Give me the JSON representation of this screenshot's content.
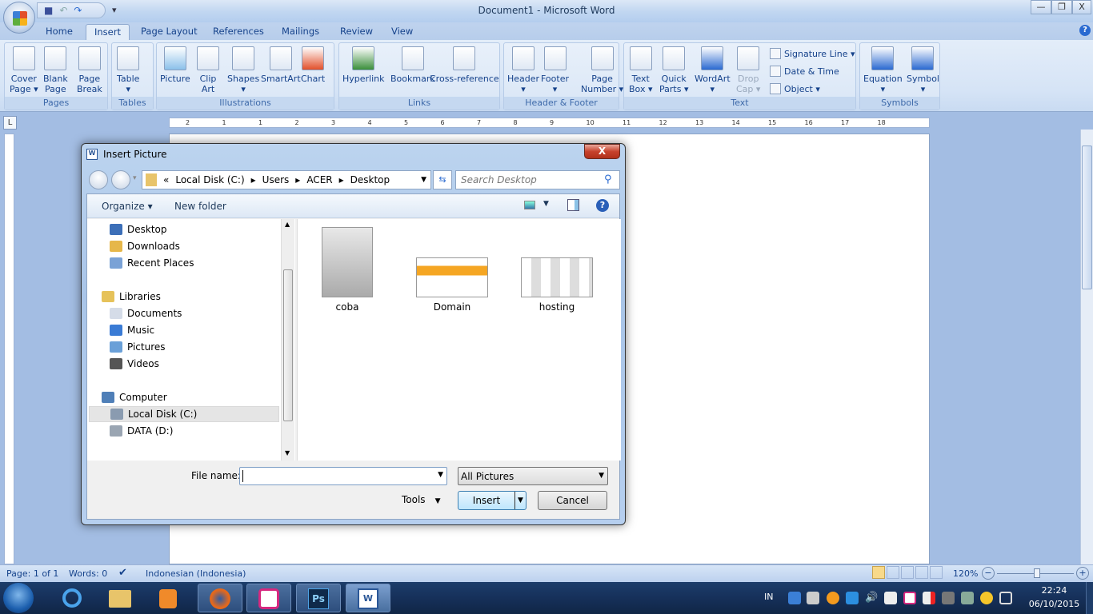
{
  "window": {
    "title": "Document1 - Microsoft Word",
    "minimize": "—",
    "restore": "❐",
    "close": "X"
  },
  "tabs": [
    "Home",
    "Insert",
    "Page Layout",
    "References",
    "Mailings",
    "Review",
    "View"
  ],
  "active_tab": "Insert",
  "ribbon": {
    "groups": [
      {
        "label": "Pages",
        "buttons": [
          "Cover\nPage ▾",
          "Blank\nPage",
          "Page\nBreak"
        ]
      },
      {
        "label": "Tables",
        "buttons": [
          "Table\n▾"
        ]
      },
      {
        "label": "Illustrations",
        "buttons": [
          "Picture",
          "Clip\nArt",
          "Shapes\n▾",
          "SmartArt",
          "Chart"
        ]
      },
      {
        "label": "Links",
        "buttons": [
          "Hyperlink",
          "Bookmark",
          "Cross-reference"
        ]
      },
      {
        "label": "Header & Footer",
        "buttons": [
          "Header\n▾",
          "Footer\n▾",
          "Page\nNumber ▾"
        ]
      },
      {
        "label": "Text",
        "buttons": [
          "Text\nBox ▾",
          "Quick\nParts ▾",
          "WordArt\n▾",
          "Drop\nCap ▾"
        ],
        "small": [
          "Signature Line ▾",
          "Date & Time",
          "Object ▾"
        ]
      },
      {
        "label": "Symbols",
        "buttons": [
          "Equation\n▾",
          "Symbol\n▾"
        ]
      }
    ]
  },
  "ruler": {
    "corner": "L",
    "ticks": [
      "2",
      "1",
      "1",
      "2",
      "3",
      "4",
      "5",
      "6",
      "7",
      "8",
      "9",
      "10",
      "11",
      "12",
      "13",
      "14",
      "15",
      "16",
      "17",
      "18"
    ]
  },
  "dialog": {
    "title": "Insert Picture",
    "close": "X",
    "breadcrumb": [
      "«",
      "Local Disk (C:)",
      "Users",
      "ACER",
      "Desktop"
    ],
    "search_placeholder": "Search Desktop",
    "toolbar": {
      "organize": "Organize ▾",
      "new_folder": "New folder"
    },
    "nav": [
      {
        "label": "Desktop",
        "color": "#3c6fb8",
        "level": 2
      },
      {
        "label": "Downloads",
        "color": "#e6b74a",
        "level": 2
      },
      {
        "label": "Recent Places",
        "color": "#7aa2d6",
        "level": 2
      },
      {
        "label": "Libraries",
        "color": "#e6c25a",
        "level": 1
      },
      {
        "label": "Documents",
        "color": "#d5dce8",
        "level": 2
      },
      {
        "label": "Music",
        "color": "#3a7bd5",
        "level": 2
      },
      {
        "label": "Pictures",
        "color": "#6aa0d8",
        "level": 2
      },
      {
        "label": "Videos",
        "color": "#555",
        "level": 2
      },
      {
        "label": "Computer",
        "color": "#4f7fb8",
        "level": 1
      },
      {
        "label": "Local Disk (C:)",
        "color": "#8a9bb0",
        "level": 2,
        "selected": true
      },
      {
        "label": "DATA (D:)",
        "color": "#9aa5b2",
        "level": 2
      }
    ],
    "files": [
      {
        "name": "coba",
        "kind": "sketch"
      },
      {
        "name": "Domain",
        "kind": "screenshot-orange"
      },
      {
        "name": "hosting",
        "kind": "screenshot-grid"
      }
    ],
    "file_name_label": "File name:",
    "file_name_value": "",
    "file_type": "All Pictures",
    "tools": "Tools",
    "insert": "Insert",
    "cancel": "Cancel"
  },
  "status": {
    "page": "Page: 1 of 1",
    "words": "Words: 0",
    "language": "Indonesian (Indonesia)",
    "zoom": "120%",
    "zoom_percent": 120
  },
  "taskbar": {
    "language": "IN",
    "time": "22:24",
    "date": "06/10/2015",
    "apps": [
      "start",
      "internet-explorer",
      "file-explorer",
      "media-player",
      "firefox",
      "corel",
      "photoshop",
      "word"
    ]
  },
  "colors": {
    "accent": "#15428b",
    "taskbar": "#16305a",
    "ribbon": "#d6e4f6"
  }
}
